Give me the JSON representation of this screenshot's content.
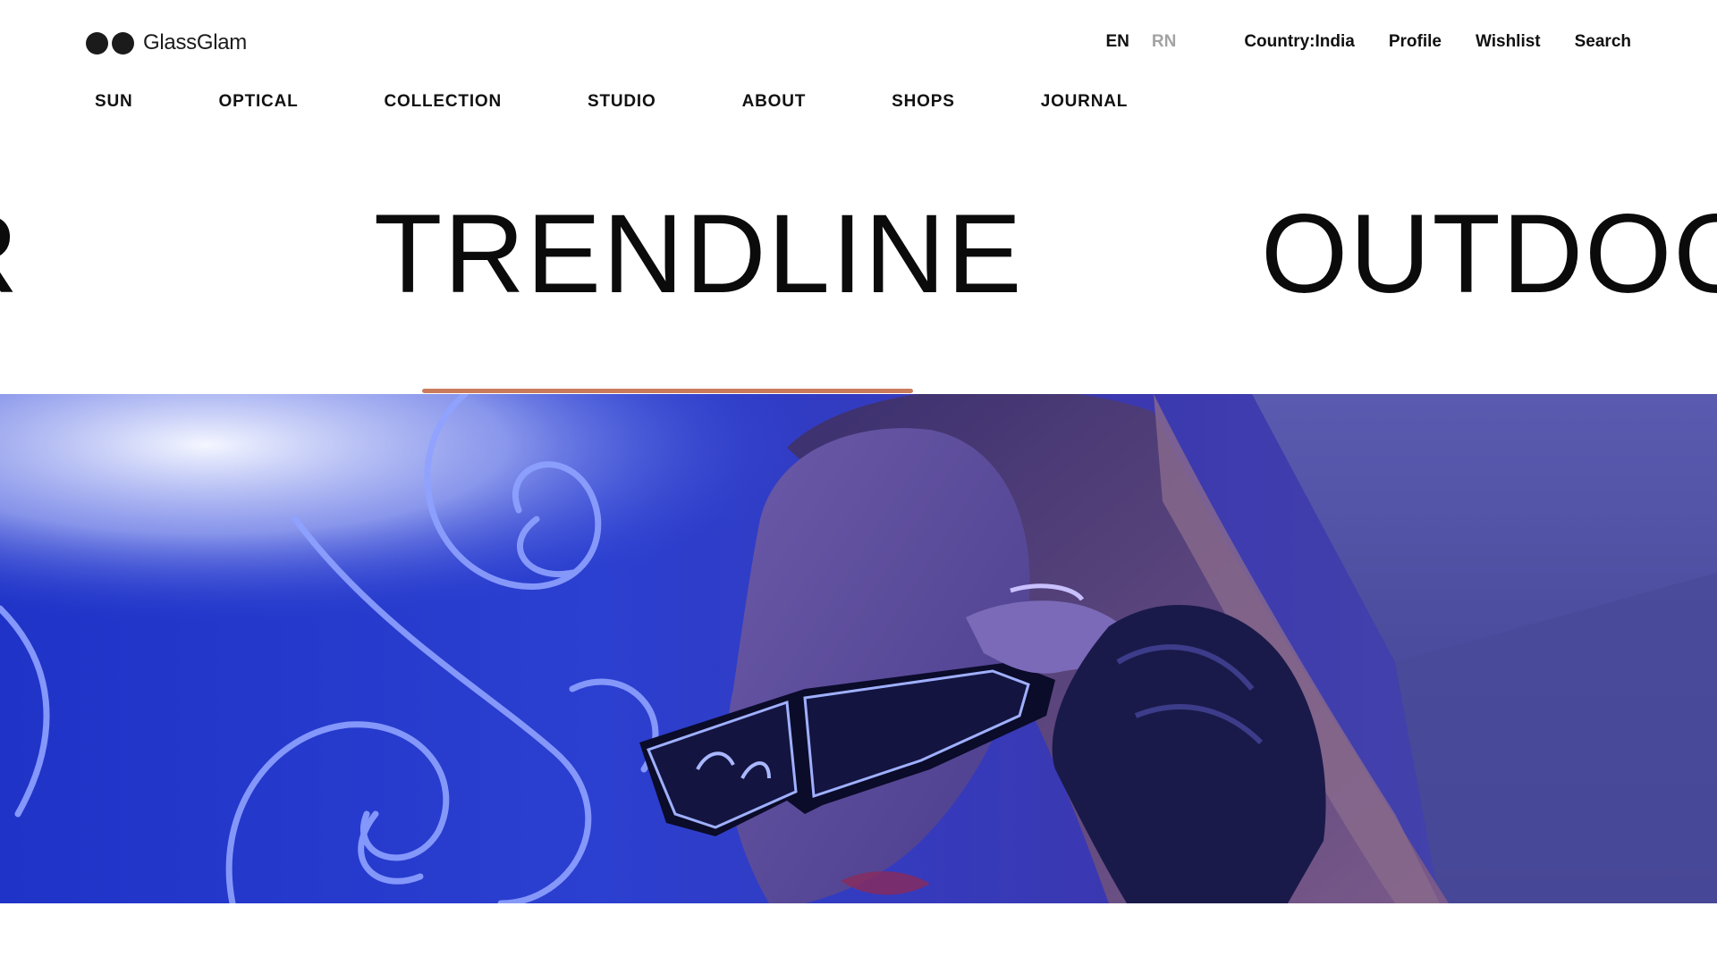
{
  "brand": {
    "name": "GlassGlam"
  },
  "utility_nav": {
    "languages": [
      {
        "label": "EN",
        "active": true
      },
      {
        "label": "RN",
        "active": false
      }
    ],
    "country": "Country:India",
    "profile": "Profile",
    "wishlist": "Wishlist",
    "search": "Search"
  },
  "main_nav": {
    "items": [
      "SUN",
      "OPTICAL",
      "COLLECTION",
      "STUDIO",
      "ABOUT",
      "SHOPS",
      "JOURNAL"
    ]
  },
  "carousel": {
    "slides": [
      {
        "label": "R",
        "state": "previous"
      },
      {
        "label": "TRENDLINE",
        "state": "active"
      },
      {
        "label": "OUTDOO",
        "state": "next"
      }
    ],
    "progress": 1.0
  },
  "colors": {
    "accent": "#c97b5c",
    "text": "#111111",
    "inactive_lang": "#a3a3a3",
    "hero_blue": "#2430c9"
  }
}
